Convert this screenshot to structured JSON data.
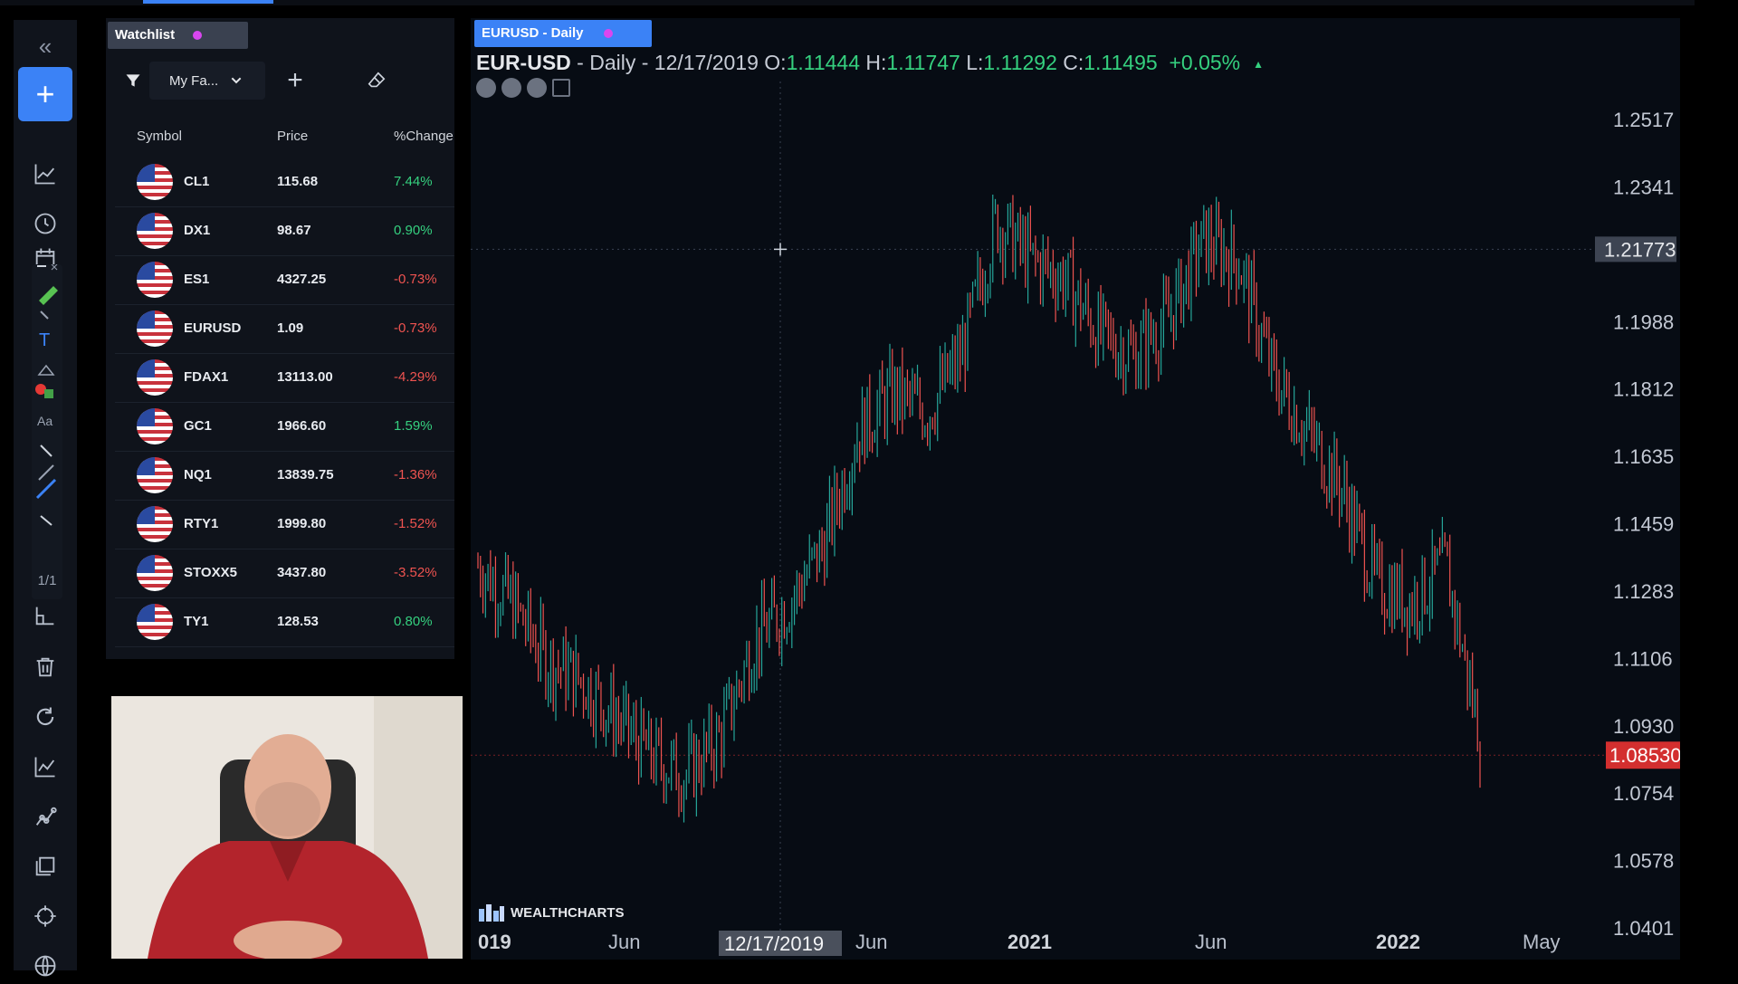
{
  "toolbar": {
    "collapse": "«",
    "add": "+",
    "drawing_page": "1/1"
  },
  "watchlist": {
    "tab_label": "Watchlist",
    "list_name": "My Fa...",
    "columns": [
      "Symbol",
      "Price",
      "%Change"
    ],
    "rows": [
      {
        "symbol": "CL1",
        "price": "115.68",
        "change": "7.44%",
        "positive": true
      },
      {
        "symbol": "DX1",
        "price": "98.67",
        "change": "0.90%",
        "positive": true
      },
      {
        "symbol": "ES1",
        "price": "4327.25",
        "change": "-0.73%",
        "positive": false
      },
      {
        "symbol": "EURUSD",
        "price": "1.09",
        "change": "-0.73%",
        "positive": false
      },
      {
        "symbol": "FDAX1",
        "price": "13113.00",
        "change": "-4.29%",
        "positive": false
      },
      {
        "symbol": "GC1",
        "price": "1966.60",
        "change": "1.59%",
        "positive": true
      },
      {
        "symbol": "NQ1",
        "price": "13839.75",
        "change": "-1.36%",
        "positive": false
      },
      {
        "symbol": "RTY1",
        "price": "1999.80",
        "change": "-1.52%",
        "positive": false
      },
      {
        "symbol": "STOXX5",
        "price": "3437.80",
        "change": "-3.52%",
        "positive": false
      },
      {
        "symbol": "TY1",
        "price": "128.53",
        "change": "0.80%",
        "positive": true
      }
    ]
  },
  "chart": {
    "tab_label": "EURUSD - Daily",
    "symbol": "EUR-USD",
    "info": " - Daily - 12/17/2019 O:",
    "open": "1.11444",
    "high_label": " H:",
    "high": "1.11747",
    "low_label": " L:",
    "low": "1.11292",
    "close_label": " C:",
    "close": "1.11495",
    "change": "+0.05%",
    "price_axis": [
      "1.2517",
      "1.2341",
      "1.1988",
      "1.1812",
      "1.1635",
      "1.1459",
      "1.1283",
      "1.1106",
      "1.0930",
      "1.0754",
      "1.0578",
      "1.0401"
    ],
    "crosshair_price": "1.21773",
    "last_price": "1.08530",
    "crosshair_date": "12/17/2019",
    "time_axis": [
      {
        "label": "019",
        "bold": true
      },
      {
        "label": "Jun",
        "bold": false
      },
      {
        "label": "Jun",
        "bold": false
      },
      {
        "label": "2021",
        "bold": true
      },
      {
        "label": "Jun",
        "bold": false
      },
      {
        "label": "2022",
        "bold": true
      },
      {
        "label": "May",
        "bold": false
      }
    ],
    "watermark": "WEALTHCHARTS",
    "colors": {
      "up": "#26a69a",
      "down": "#ef5350",
      "accent": "#3b82f6",
      "last_price_bg": "#d32f2f"
    }
  },
  "chart_data": {
    "type": "line",
    "title": "EUR-USD - Daily",
    "x": [
      "2019-10",
      "2019-11",
      "2019-12",
      "2020-01",
      "2020-02",
      "2020-03",
      "2020-04",
      "2020-05",
      "2020-06",
      "2020-07",
      "2020-08",
      "2020-09",
      "2020-10",
      "2020-11",
      "2020-12",
      "2021-01",
      "2021-02",
      "2021-03",
      "2021-04",
      "2021-05",
      "2021-06",
      "2021-07",
      "2021-08",
      "2021-09",
      "2021-10",
      "2021-11",
      "2021-12",
      "2022-01",
      "2022-02",
      "2022-03"
    ],
    "series": [
      {
        "values": [
          1.135,
          1.125,
          1.11,
          1.105,
          1.095,
          1.085,
          1.08,
          1.09,
          1.115,
          1.125,
          1.14,
          1.17,
          1.18,
          1.175,
          1.19,
          1.225,
          1.215,
          1.21,
          1.195,
          1.19,
          1.2,
          1.22,
          1.215,
          1.185,
          1.17,
          1.155,
          1.13,
          1.125,
          1.135,
          1.09
        ]
      }
    ],
    "ylim": [
      1.0401,
      1.2517
    ]
  }
}
